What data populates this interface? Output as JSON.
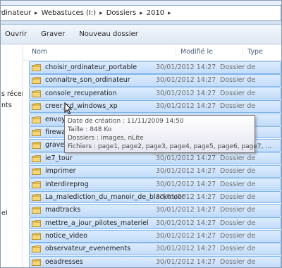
{
  "address_bar": {
    "crumbs": [
      "rdinateur",
      "Webastuces (I:)",
      "Dossiers",
      "2010"
    ]
  },
  "toolbar": {
    "open_label": "Ouvrir",
    "burn_label": "Graver",
    "new_folder_label": "Nouveau dossier"
  },
  "nav_pane": {
    "items": [
      "s récer",
      "nts",
      "el"
    ]
  },
  "columns": {
    "name": "Nom",
    "modified": "Modifié le",
    "type": "Type"
  },
  "files": [
    {
      "name": "choisir_ordinateur_portable",
      "date": "30/01/2012 14:27",
      "type": "Dossier de"
    },
    {
      "name": "connaitre_son_ordinateur",
      "date": "30/01/2012 14:27",
      "type": "Dossier de"
    },
    {
      "name": "console_recuperation",
      "date": "30/01/2012 14:27",
      "type": "Dossier de"
    },
    {
      "name": "creer_cd_windows_xp",
      "date": "30/01/2012 14:27",
      "type": "Dossier de"
    },
    {
      "name": "envoye",
      "date": "",
      "type": ""
    },
    {
      "name": "firewall",
      "date": "",
      "type": ""
    },
    {
      "name": "graver_",
      "date": "",
      "type": ""
    },
    {
      "name": "ie7_tour",
      "date": "30/01/2012 14:27",
      "type": "Dossier de"
    },
    {
      "name": "imprimer",
      "date": "30/01/2012 14:27",
      "type": "Dossier de"
    },
    {
      "name": "interdireprog",
      "date": "30/01/2012 14:27",
      "type": "Dossier de"
    },
    {
      "name": "La_malediction_du_manoir_de_blackmoor",
      "date": "30/01/2012 14:27",
      "type": "Dossier de"
    },
    {
      "name": "madtracks",
      "date": "30/01/2012 14:27",
      "type": "Dossier de"
    },
    {
      "name": "mettre_a_jour_pilotes_materiel",
      "date": "30/01/2012 14:27",
      "type": "Dossier de"
    },
    {
      "name": "notice_video",
      "date": "30/01/2012 14:27",
      "type": "Dossier de"
    },
    {
      "name": "observateur_evenements",
      "date": "30/01/2012 14:27",
      "type": "Dossier de"
    },
    {
      "name": "oeadresses",
      "date": "30/01/2012 14:27",
      "type": "Dossier de"
    }
  ],
  "tooltip": {
    "created": "Date de création : 11/11/2009 14:50",
    "size": "Taille : 848 Ko",
    "folders": "Dossiers : images, nLite",
    "files": "Fichiers : page1, page2, page3, page4, page5, page6, page7, ..."
  },
  "colors": {
    "selection_fill": "#c4ddfb",
    "selection_border": "#7eb4ea",
    "folder": "#e8c45c"
  }
}
